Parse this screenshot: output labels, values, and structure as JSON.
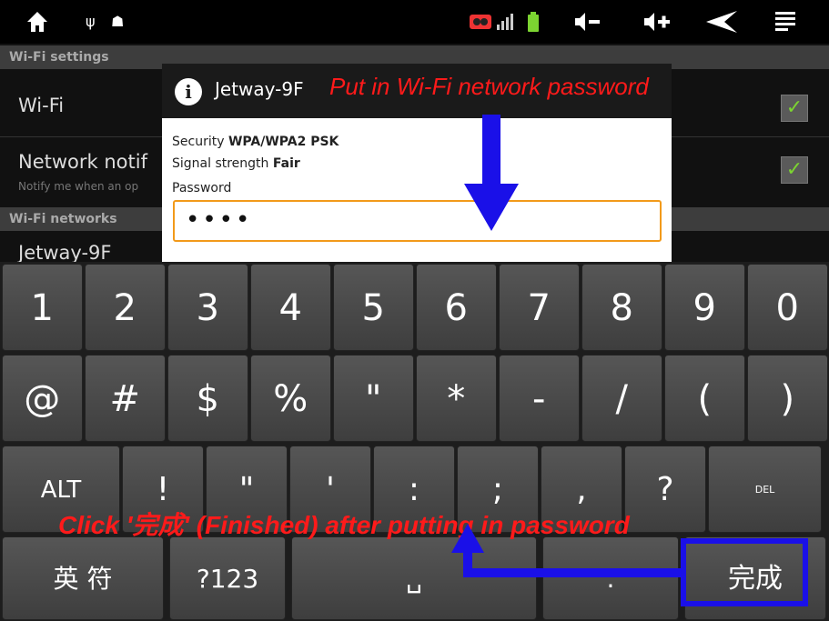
{
  "status_bar": {
    "icons": [
      "home-icon",
      "usb-icon",
      "android-debug-icon",
      "wifi-icon",
      "signal-icon",
      "battery-icon",
      "volume-down-icon",
      "volume-up-icon",
      "back-icon",
      "menu-icon"
    ]
  },
  "settings": {
    "section_wifi_settings": "Wi-Fi settings",
    "wifi_title": "Wi-Fi",
    "network_notif_title": "Network notif",
    "network_notif_sub": "Notify me when an op",
    "section_wifi_networks": "Wi-Fi networks",
    "network_item": "Jetway-9F"
  },
  "dialog": {
    "title": "Jetway-9F",
    "security_label": "Security",
    "security_value": "WPA/WPA2 PSK",
    "signal_label": "Signal strength",
    "signal_value": "Fair",
    "password_label": "Password",
    "password_value": "••••"
  },
  "annotations": {
    "top": "Put in Wi-Fi network password",
    "bottom": "Click '完成' (Finished) after putting in password"
  },
  "keyboard": {
    "row1": [
      "1",
      "2",
      "3",
      "4",
      "5",
      "6",
      "7",
      "8",
      "9",
      "0"
    ],
    "row2": [
      "@",
      "#",
      "$",
      "%",
      "\"",
      "*",
      "-",
      "/",
      "(",
      ")"
    ],
    "row3": [
      "ALT",
      "!",
      "\"",
      "'",
      ":",
      ";",
      ",",
      "?",
      "DEL"
    ],
    "row4": [
      "英 符",
      "?123",
      "␣",
      ".",
      "完成"
    ]
  },
  "colors": {
    "annotation_red": "#ff1a1a",
    "arrow_blue": "#1a10e8",
    "field_orange": "#f29a1a",
    "check_green": "#7cd431"
  }
}
